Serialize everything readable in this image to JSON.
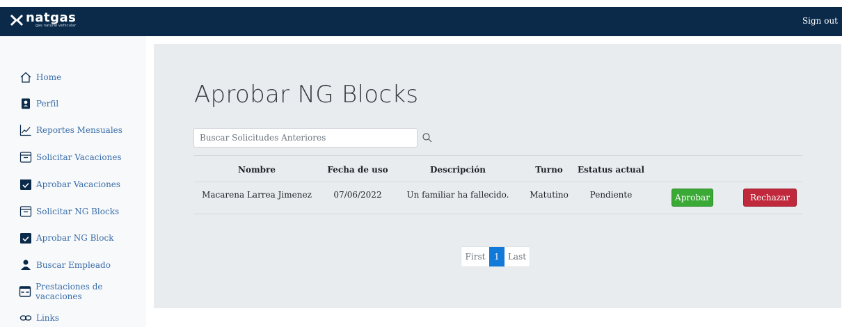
{
  "header": {
    "brand": {
      "name": "natgas",
      "tagline": "gas natural vehicular"
    },
    "signout_label": "Sign out"
  },
  "sidebar": {
    "items": [
      {
        "label": "Home",
        "icon": "house-icon"
      },
      {
        "label": "Perfil",
        "icon": "profile-badge-icon"
      },
      {
        "label": "Reportes Mensuales",
        "icon": "line-chart-icon"
      },
      {
        "label": "Solicitar Vacaciones",
        "icon": "inbox-icon"
      },
      {
        "label": "Aprobar Vacaciones",
        "icon": "calendar-check-icon"
      },
      {
        "label": "Solicitar NG Blocks",
        "icon": "inbox-icon"
      },
      {
        "label": "Aprobar NG Block",
        "icon": "calendar-check-icon"
      },
      {
        "label": "Buscar Empleado",
        "icon": "person-icon"
      },
      {
        "label": "Prestaciones de vacaciones",
        "icon": "calendar-range-icon"
      },
      {
        "label": "Links",
        "icon": "link-icon"
      }
    ]
  },
  "main": {
    "title": "Aprobar NG Blocks",
    "search": {
      "placeholder": "Buscar Solicitudes Anteriores",
      "value": ""
    },
    "table": {
      "headers": [
        "Nombre",
        "Fecha de uso",
        "Descripción",
        "Turno",
        "Estatus actual"
      ],
      "rows": [
        {
          "nombre": "Macarena Larrea Jimenez",
          "fecha": "07/06/2022",
          "descripcion": "Un familiar ha fallecido.",
          "turno": "Matutino",
          "estatus": "Pendiente",
          "approve_label": "Aprobar",
          "reject_label": "Rechazar"
        }
      ]
    },
    "pagination": {
      "first": "First",
      "current": "1",
      "last": "Last"
    }
  },
  "colors": {
    "topbar": "#0b2a4a",
    "link": "#3b6ea8",
    "approve": "#3aa935",
    "reject": "#c0283b",
    "page_active": "#1379d8"
  }
}
